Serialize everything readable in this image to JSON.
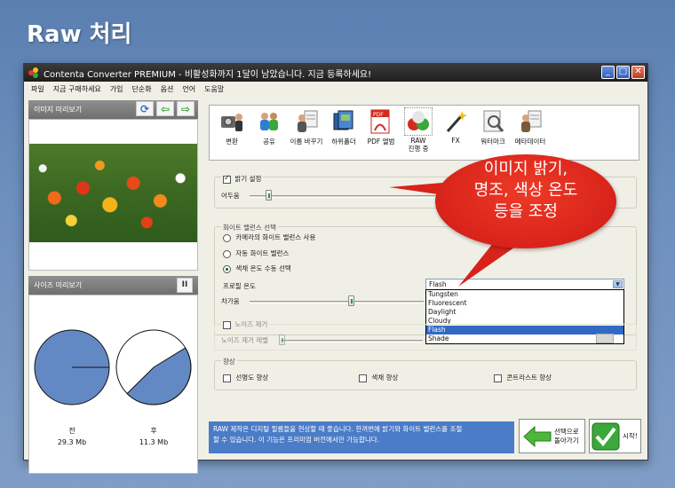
{
  "slide": {
    "title": "Raw 처리"
  },
  "window": {
    "title": "Contenta Converter PREMIUM - 비활성화까지 1달이 남았습니다. 지금 등록하세요!",
    "minimize": "_",
    "maximize": "□",
    "close": "✕"
  },
  "menu": {
    "items": [
      "파일",
      "지금 구매하세요",
      "가입",
      "단순화",
      "옵션",
      "언어",
      "도움말"
    ]
  },
  "image_preview": {
    "label": "이미지 미리보기"
  },
  "size_preview": {
    "label": "사이즈 미리보기",
    "pause": "II",
    "before_label": "전",
    "before_size": "29.3 Mb",
    "after_label": "후",
    "after_size": "11.3 Mb"
  },
  "toolbar": {
    "items": [
      {
        "label": "변환"
      },
      {
        "label": "공유"
      },
      {
        "label": "이름 바꾸기"
      },
      {
        "label": "하위폴더"
      },
      {
        "label": "PDF 앨범"
      },
      {
        "label": "RAW\n진행 중"
      },
      {
        "label": "FX"
      },
      {
        "label": "워터마크"
      },
      {
        "label": "메타데이터"
      }
    ]
  },
  "brightness": {
    "label": "밝기 설정",
    "darkness": "어두움",
    "level": 0.08
  },
  "white_balance": {
    "label": "화이트 밸런스 선택",
    "opt_camera": "카메라의 화이트 밸런스 사용",
    "opt_auto": "자동 화이트 밸런스",
    "opt_manual": "색채 온도 수동 선택",
    "profile_label": "프로필 온도",
    "profile_value": "Flash",
    "options": [
      "Tungsten",
      "Fluorescent",
      "Daylight",
      "Cloudy",
      "Flash",
      "Shade"
    ],
    "selected_index": 4,
    "cool_label": "차가움",
    "cool_level": 0.58
  },
  "noise": {
    "label": "노이즈 제거",
    "level_label": "노이즈 제거 레벨"
  },
  "enhance": {
    "label": "향상",
    "sharpness": "선명도 향상",
    "color": "색채 향상",
    "contrast": "콘트라스트 향상"
  },
  "info": {
    "line1": "RAW 제작은 디지털 필름들을 현상할 때 좋습니다. 한꺼번에 밝기와 화이트 밸런스를 조절",
    "line2": "할 수 있습니다. 이 기능은 프리미엄 버전에서만 가능합니다."
  },
  "buttons": {
    "back_line1": "선택으로",
    "back_line2": "돌아가기",
    "start": "시작!"
  },
  "callout": {
    "line1": "이미지 밝기,",
    "line2": "명조, 색상 온도",
    "line3": "등을 조정"
  }
}
